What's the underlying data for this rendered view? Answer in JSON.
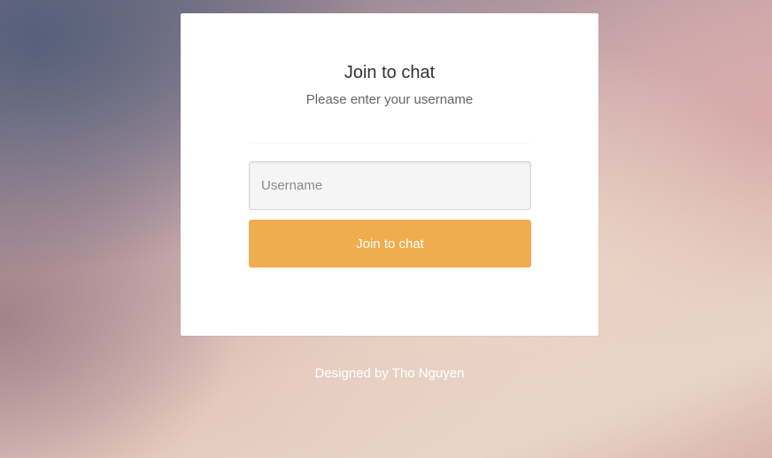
{
  "login": {
    "title": "Join to chat",
    "subtitle": "Please enter your username",
    "username_placeholder": "Username",
    "username_value": "",
    "submit_label": "Join to chat"
  },
  "footer": {
    "credit": "Designed by Tho Nguyen"
  },
  "colors": {
    "button": "#f0ad4e",
    "card": "#ffffff"
  }
}
